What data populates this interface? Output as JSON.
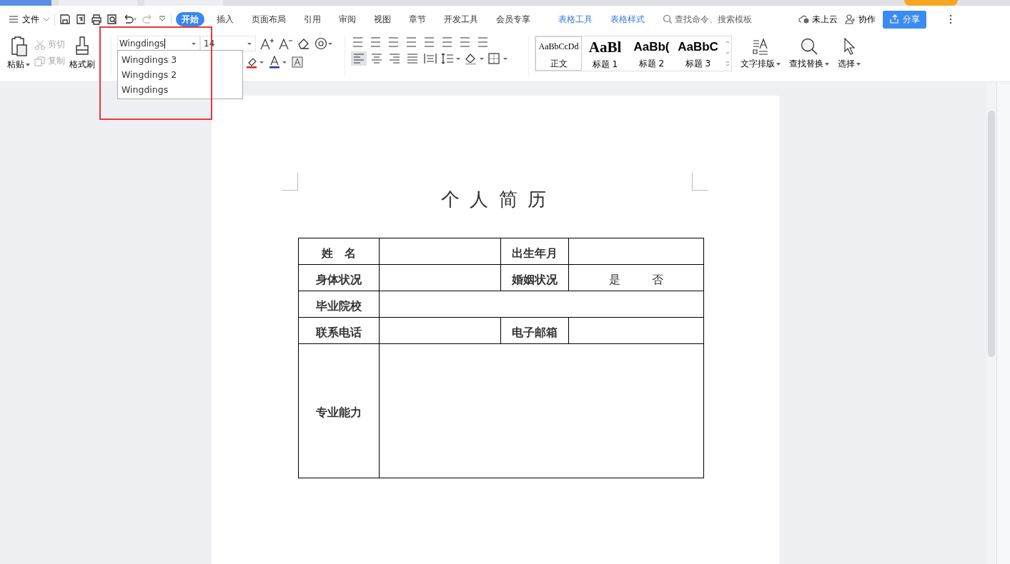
{
  "doc_tabs": [
    {
      "selected": true
    },
    {
      "selected": false
    },
    {
      "selected": false
    }
  ],
  "menu": {
    "file": "文件",
    "tabs": [
      {
        "label": "开始",
        "selected": true,
        "kind": "tab"
      },
      {
        "label": "插入",
        "selected": false,
        "kind": "tab"
      },
      {
        "label": "页面布局",
        "selected": false,
        "kind": "tab"
      },
      {
        "label": "引用",
        "selected": false,
        "kind": "tab"
      },
      {
        "label": "审阅",
        "selected": false,
        "kind": "tab"
      },
      {
        "label": "视图",
        "selected": false,
        "kind": "tab"
      },
      {
        "label": "章节",
        "selected": false,
        "kind": "tab"
      },
      {
        "label": "开发工具",
        "selected": false,
        "kind": "tab"
      },
      {
        "label": "会员专享",
        "selected": false,
        "kind": "tab"
      },
      {
        "label": "表格工具",
        "selected": false,
        "kind": "context"
      },
      {
        "label": "表格样式",
        "selected": false,
        "kind": "context"
      }
    ],
    "search": {
      "placeholder": "查找命令、搜索模板"
    },
    "cloud": "未上云",
    "collab": "协作",
    "share": "分享"
  },
  "clipboard": {
    "paste": "粘贴",
    "cut": {
      "label": "剪切",
      "disabled": true
    },
    "copy": {
      "label": "复制",
      "disabled": true
    },
    "painter": "格式刷"
  },
  "font": {
    "name": "Wingdings",
    "size": "14",
    "options": [
      "Wingdings 3",
      "Wingdings 2",
      "Wingdings"
    ]
  },
  "styles": [
    {
      "sample": "AaBbCcDd",
      "label": "正文",
      "kind": "normal",
      "selected": true
    },
    {
      "sample": "AaBl",
      "label": "标题 1",
      "kind": "h1",
      "selected": false
    },
    {
      "sample": "AaBb(",
      "label": "标题 2",
      "kind": "h2",
      "selected": false
    },
    {
      "sample": "AaBbC",
      "label": "标题 3",
      "kind": "h3",
      "selected": false
    }
  ],
  "tools": [
    {
      "label": "文字排版",
      "kind": "layout"
    },
    {
      "label": "查找替换",
      "kind": "find"
    },
    {
      "label": "选择",
      "kind": "select"
    }
  ],
  "document": {
    "title": "个 人 简 历",
    "rows": [
      {
        "kind": "pair",
        "label": "姓　名",
        "label2": "出生年月"
      },
      {
        "kind": "pair",
        "label": "身体状况",
        "label2": "婚姻状况",
        "value2": [
          "是",
          "否"
        ]
      },
      {
        "kind": "wide",
        "label": "毕业院校"
      },
      {
        "kind": "pair",
        "label": "联系电话",
        "label2": "电子邮箱"
      },
      {
        "kind": "tall",
        "label": "专业能力"
      }
    ]
  }
}
